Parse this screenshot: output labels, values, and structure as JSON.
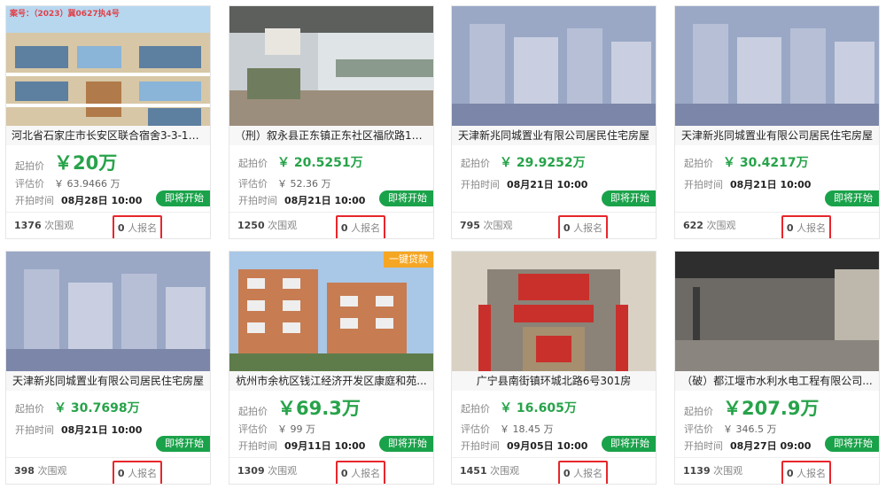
{
  "labels": {
    "start_price": "起拍价",
    "estimate": "评估价",
    "start_time": "开拍时间",
    "views_suffix": "次围观",
    "signup_suffix": "人报名",
    "status": "即将开始"
  },
  "cards": [
    {
      "title": "河北省石家庄市长安区联合宿舍3-3-10...",
      "price": "￥20万",
      "estimate": "￥ 63.9466 万",
      "time": "08月28日 10:00",
      "views": "1376",
      "signups": "0",
      "stamp": "案号：（2023）冀0627执4号"
    },
    {
      "title": "（刑）叙永县正东镇正东社区福欣路11...",
      "price": "￥ 20.5251万",
      "estimate": "￥ 52.36 万",
      "time": "08月21日 10:00",
      "views": "1250",
      "signups": "0"
    },
    {
      "title": "天津新兆同城置业有限公司居民住宅房屋",
      "price": "￥ 29.9252万",
      "estimate": "",
      "time": "08月21日 10:00",
      "views": "795",
      "signups": "0"
    },
    {
      "title": "天津新兆同城置业有限公司居民住宅房屋",
      "price": "￥ 30.4217万",
      "estimate": "",
      "time": "08月21日 10:00",
      "views": "622",
      "signups": "0"
    },
    {
      "title": "天津新兆同城置业有限公司居民住宅房屋",
      "price": "￥ 30.7698万",
      "estimate": "",
      "time": "08月21日 10:00",
      "views": "398",
      "signups": "0"
    },
    {
      "title": "杭州市余杭区钱江经济开发区康庭和苑...",
      "price": "￥69.3万",
      "estimate": "￥ 99 万",
      "time": "09月11日 10:00",
      "views": "1309",
      "signups": "0",
      "tag": "一键贷款"
    },
    {
      "title": "广宁县南街镇环城北路6号301房",
      "price": "￥ 16.605万",
      "estimate": "￥ 18.45 万",
      "time": "09月05日 10:00",
      "views": "1451",
      "signups": "0"
    },
    {
      "title": "（破）都江堰市水利水电工程有限公司...",
      "price": "￥207.9万",
      "estimate": "￥ 346.5 万",
      "time": "08月27日 09:00",
      "views": "1139",
      "signups": "0"
    }
  ]
}
